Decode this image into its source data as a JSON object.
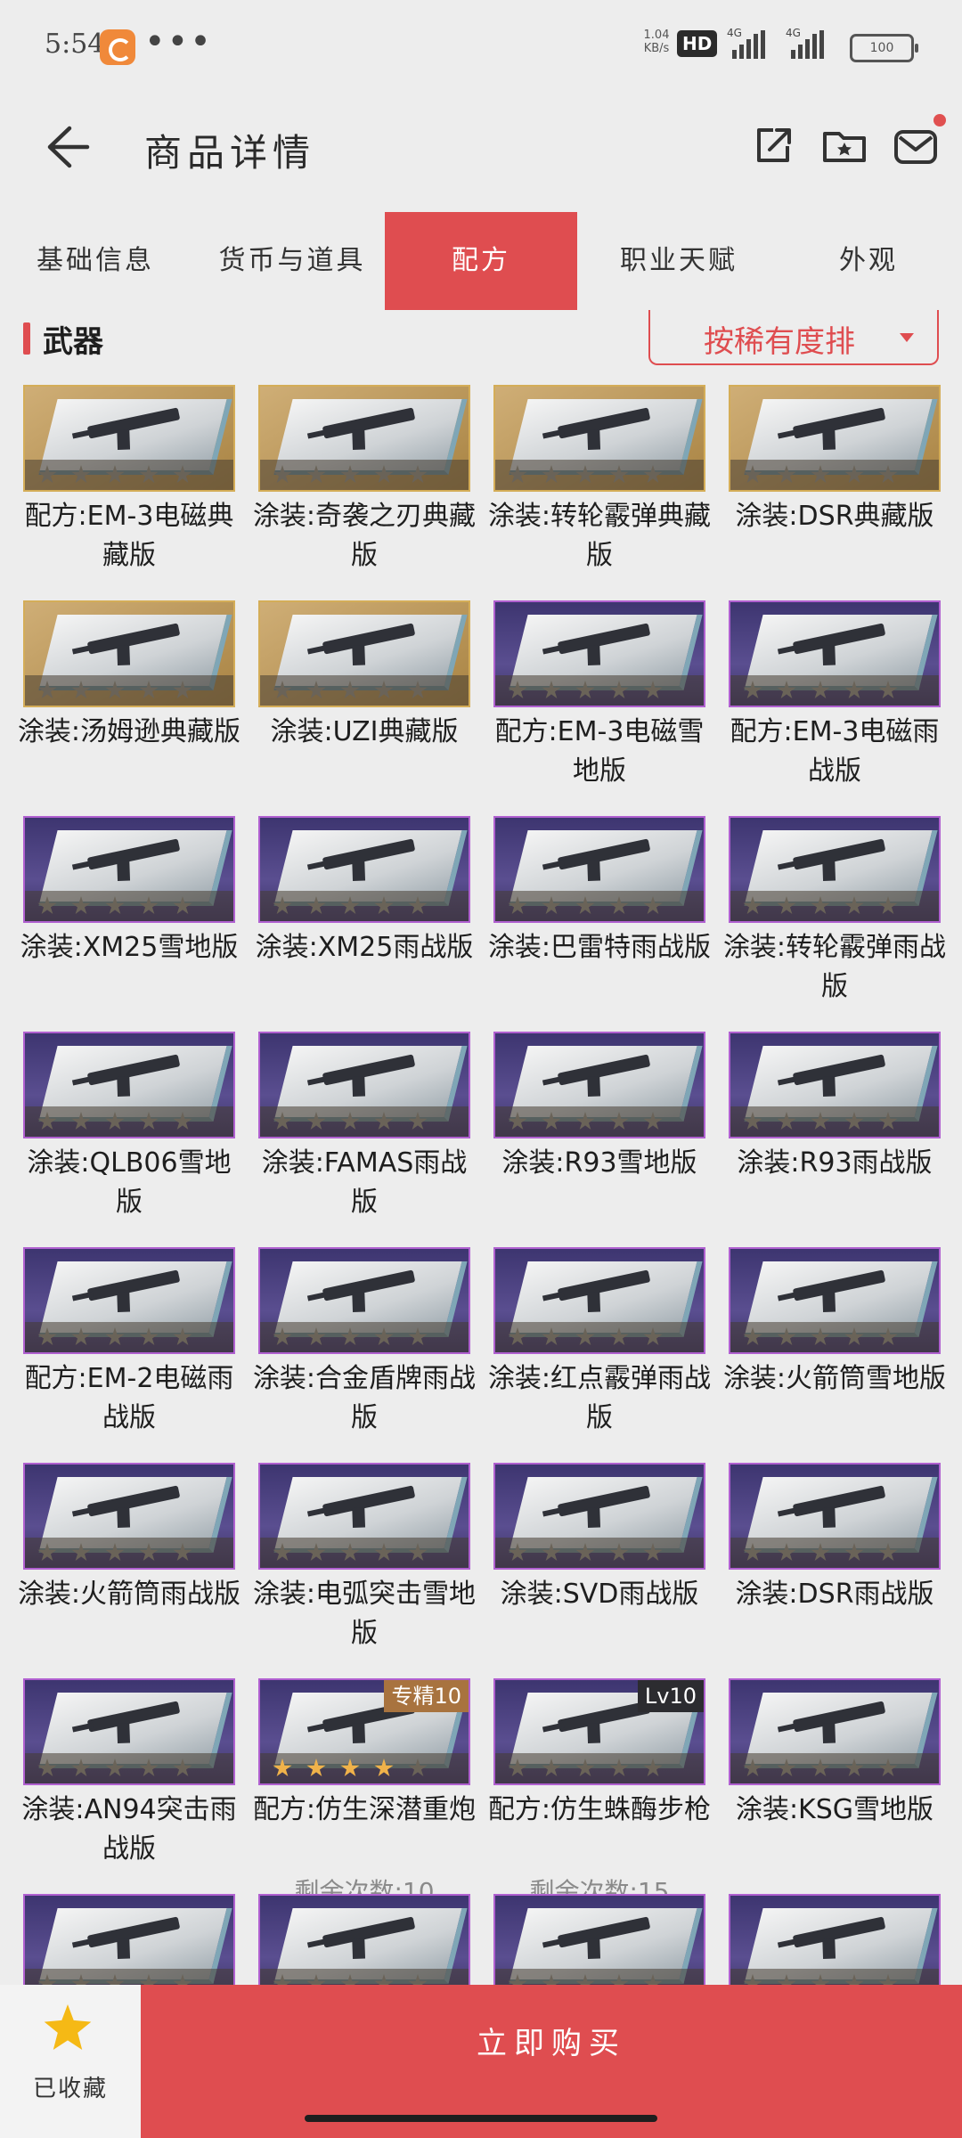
{
  "status_bar": {
    "time": "5:54",
    "more": "•••",
    "net_speed_1": "1.04",
    "net_speed_2": "KB/s",
    "hd": "HD",
    "sig1": "4G",
    "sig2": "4G",
    "battery": "100"
  },
  "header": {
    "title": "商品详情"
  },
  "tabs": [
    {
      "label": "基础信息"
    },
    {
      "label": "货币与道具"
    },
    {
      "label": "配方"
    },
    {
      "label": "职业天赋"
    },
    {
      "label": "外观"
    }
  ],
  "section": {
    "title": "武器",
    "sort_label": "按稀有度排"
  },
  "items": [
    {
      "name": "配方:EM-3电磁典藏版",
      "rarity": "gold"
    },
    {
      "name": "涂装:奇袭之刃典藏版",
      "rarity": "gold"
    },
    {
      "name": "涂装:转轮霰弹典藏版",
      "rarity": "gold"
    },
    {
      "name": "涂装:DSR典藏版",
      "rarity": "gold"
    },
    {
      "name": "涂装:汤姆逊典藏版",
      "rarity": "gold"
    },
    {
      "name": "涂装:UZI典藏版",
      "rarity": "gold"
    },
    {
      "name": "配方:EM-3电磁雪地版",
      "rarity": "purple"
    },
    {
      "name": "配方:EM-3电磁雨战版",
      "rarity": "purple"
    },
    {
      "name": "涂装:XM25雪地版",
      "rarity": "purple"
    },
    {
      "name": "涂装:XM25雨战版",
      "rarity": "purple"
    },
    {
      "name": "涂装:巴雷特雨战版",
      "rarity": "purple"
    },
    {
      "name": "涂装:转轮霰弹雨战版",
      "rarity": "purple"
    },
    {
      "name": "涂装:QLB06雪地版",
      "rarity": "purple"
    },
    {
      "name": "涂装:FAMAS雨战版",
      "rarity": "purple"
    },
    {
      "name": "涂装:R93雪地版",
      "rarity": "purple"
    },
    {
      "name": "涂装:R93雨战版",
      "rarity": "purple"
    },
    {
      "name": "配方:EM-2电磁雨战版",
      "rarity": "purple"
    },
    {
      "name": "涂装:合金盾牌雨战版",
      "rarity": "purple"
    },
    {
      "name": "涂装:红点霰弹雨战版",
      "rarity": "purple"
    },
    {
      "name": "涂装:火箭筒雪地版",
      "rarity": "purple"
    },
    {
      "name": "涂装:火箭筒雨战版",
      "rarity": "purple"
    },
    {
      "name": "涂装:电弧突击雪地版",
      "rarity": "purple"
    },
    {
      "name": "涂装:SVD雨战版",
      "rarity": "purple"
    },
    {
      "name": "涂装:DSR雨战版",
      "rarity": "purple"
    },
    {
      "name": "涂装:AN94突击雨战版",
      "rarity": "purple"
    },
    {
      "name": "配方:仿生深潜重炮",
      "rarity": "purple",
      "badge": "专精10",
      "badge_style": "orange",
      "lit_stars": 4,
      "extra": "剩余次数:10"
    },
    {
      "name": "配方:仿生蛛酶步枪",
      "rarity": "purple",
      "badge": "Lv10",
      "badge_style": "dark",
      "extra": "剩余次数:15"
    },
    {
      "name": "涂装:KSG雪地版",
      "rarity": "purple"
    },
    {
      "name": "",
      "rarity": "purple"
    },
    {
      "name": "",
      "rarity": "purple"
    },
    {
      "name": "",
      "rarity": "purple"
    },
    {
      "name": "",
      "rarity": "purple"
    }
  ],
  "bottom_bar": {
    "favorite_label": "已收藏",
    "buy_label": "立即购买"
  },
  "colors": {
    "accent": "#df4d50",
    "background": "#ededed",
    "gold_frame": "#d4ad58",
    "purple_frame": "#b060d0",
    "favorite_star": "#f5b915"
  }
}
